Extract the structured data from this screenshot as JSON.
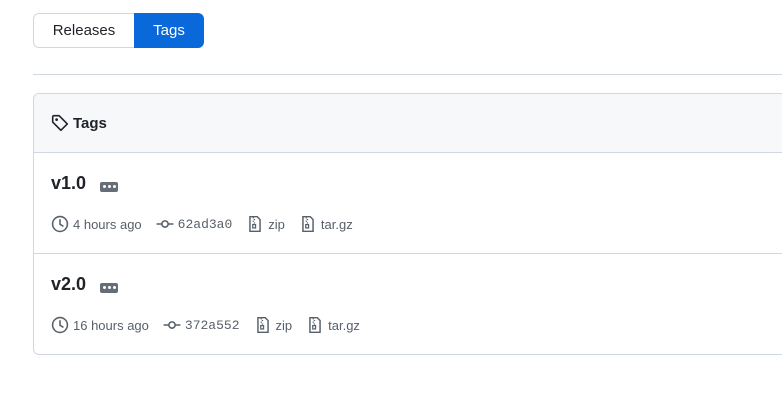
{
  "tabs": {
    "releases_label": "Releases",
    "tags_label": "Tags"
  },
  "box": {
    "title": "Tags"
  },
  "tags": [
    {
      "name": "v1.0",
      "time": "4 hours ago",
      "sha": "62ad3a0",
      "zip": "zip",
      "targz": "tar.gz"
    },
    {
      "name": "v2.0",
      "time": "16 hours ago",
      "sha": "372a552",
      "zip": "zip",
      "targz": "tar.gz"
    }
  ],
  "colors": {
    "accent": "#0969da",
    "border": "#d0d7de",
    "muted": "#57606a",
    "header_bg": "#f6f8fa"
  },
  "icons": [
    "tag-icon",
    "ellipsis-icon",
    "clock-icon",
    "commit-icon",
    "file-zip-icon"
  ]
}
